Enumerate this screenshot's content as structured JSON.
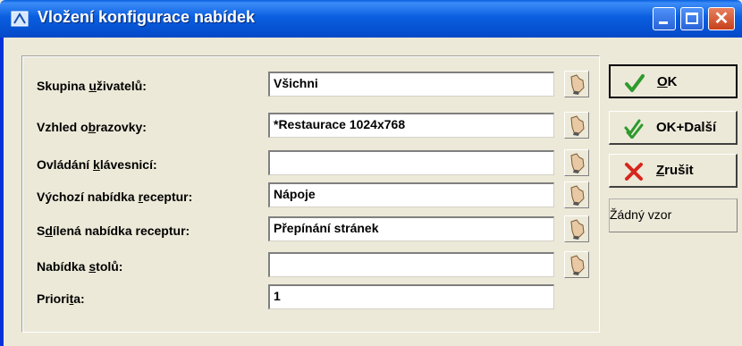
{
  "window": {
    "title": "Vložení konfigurace nabídek"
  },
  "form": {
    "rows": [
      {
        "label_pre": "Skupina ",
        "label_u": "u",
        "label_post": "živatelů:",
        "value": "Všichni"
      },
      {
        "label_pre": "Vzhled o",
        "label_u": "b",
        "label_post": "razovky:",
        "value": "*Restaurace 1024x768"
      },
      {
        "label_pre": "Ovládání ",
        "label_u": "k",
        "label_post": "lávesnicí:",
        "value": ""
      },
      {
        "label_pre": "Výchozí nabídka ",
        "label_u": "r",
        "label_post": "eceptur:",
        "value": "Nápoje"
      },
      {
        "label_pre": "S",
        "label_u": "d",
        "label_post": "ílená nabídka receptur:",
        "value": "Přepínání stránek"
      },
      {
        "label_pre": "Nabídka ",
        "label_u": "s",
        "label_post": "tolů:",
        "value": ""
      },
      {
        "label_pre": "Priori",
        "label_u": "t",
        "label_post": "a:",
        "value": "1"
      }
    ]
  },
  "buttons": {
    "ok": {
      "u": "O",
      "post": "K"
    },
    "okdalsi": {
      "label": "OK+Další"
    },
    "zrusit": {
      "u": "Z",
      "post": "rušit"
    },
    "zadny": {
      "label": "Žádný vzor"
    }
  },
  "colors": {
    "titlebar": "#0a5fe0",
    "ok_check": "#2e9a2e",
    "cancel_x": "#d8261b"
  },
  "icons": {
    "pick": "pointing-hand-icon",
    "ok": "checkmark-icon",
    "okdalsi": "double-checkmark-icon",
    "zrusit": "red-x-icon"
  }
}
